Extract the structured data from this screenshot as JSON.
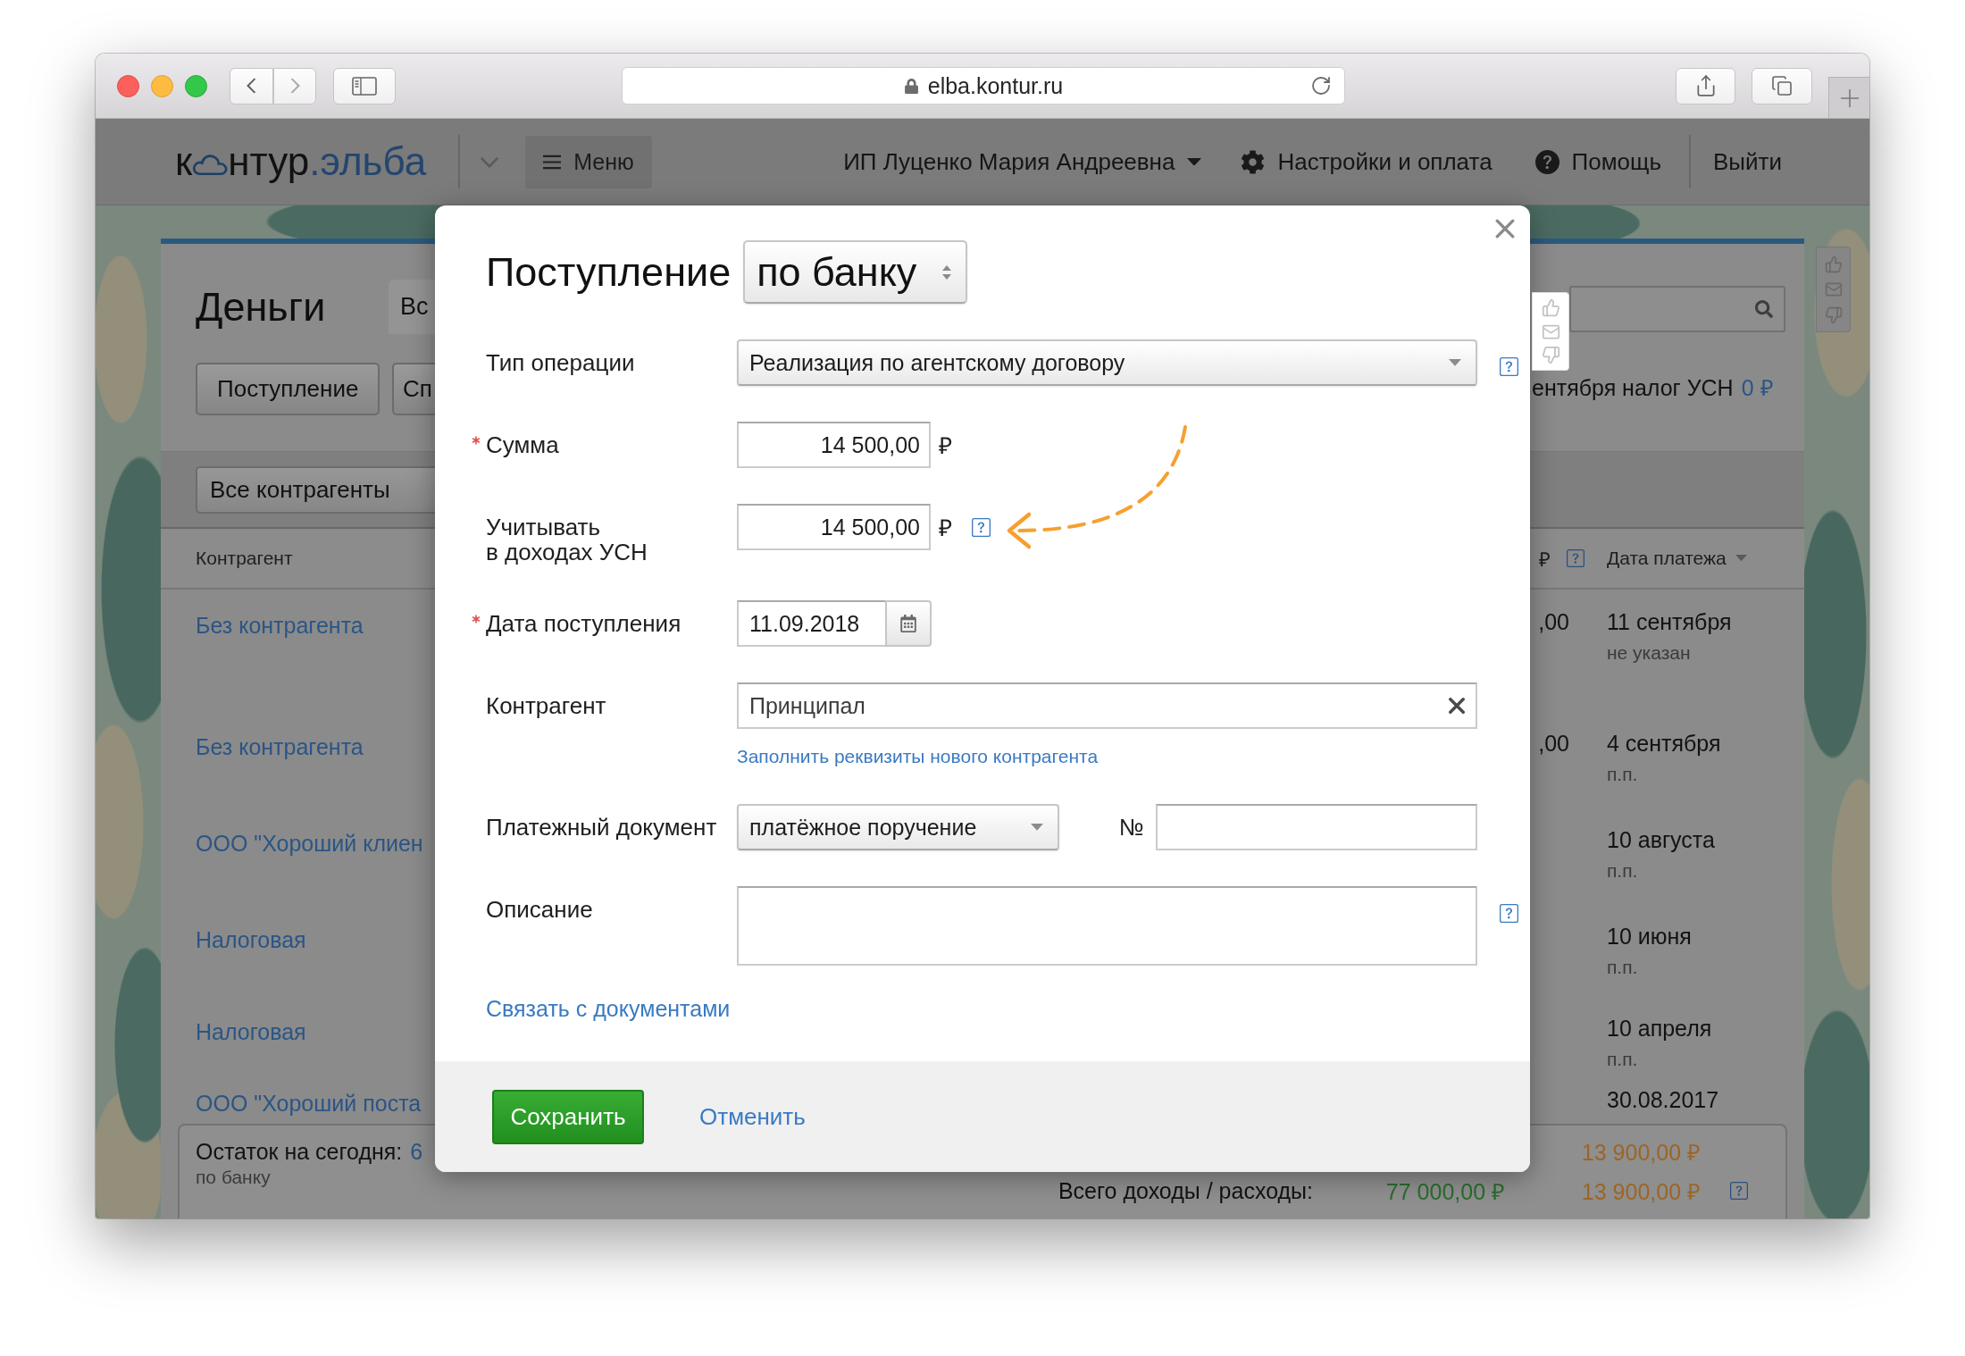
{
  "browser": {
    "url": "elba.kontur.ru"
  },
  "header": {
    "logo": {
      "first_letter": "к",
      "rest": "нтур",
      "product": ".эльба"
    },
    "menu": "Меню",
    "account": "ИП Луценко Мария Андреевна",
    "settings": "Настройки и оплата",
    "help": "Помощь",
    "logout": "Выйти"
  },
  "money": {
    "title": "Деньги",
    "tab": "Вс",
    "buttons": [
      "Поступление",
      "Сп"
    ],
    "tax_notice": "ентября налог УСН",
    "tax_amount": "0 ₽",
    "filter": "Все контрагенты",
    "columns": {
      "counterparty": "Контрагент",
      "currency": "₽",
      "date": "Дата платежа"
    },
    "rows": [
      {
        "counterparty": "Без контрагента",
        "amount": ",00",
        "date": "11 сентября",
        "document": "не указан"
      },
      {
        "counterparty": "Без контрагента",
        "amount": ",00",
        "date": "4 сентября",
        "document": "п.п."
      },
      {
        "counterparty": "ООО \"Хороший клиен",
        "date": "10 августа",
        "document": "п.п."
      },
      {
        "counterparty": "Налоговая",
        "date": "10 июня",
        "document": "п.п."
      },
      {
        "counterparty": "Налоговая",
        "date": "10 апреля",
        "document": "п.п."
      },
      {
        "counterparty": "ООО \"Хороший поста",
        "date": "30.08.2017"
      }
    ],
    "totals": {
      "balance_label": "Остаток на сегодня:",
      "balance_value": "6",
      "balance_note": "по банку",
      "today_expense": "13 900,00 ₽",
      "label": "Всего доходы / расходы:",
      "income": "77 000,00 ₽",
      "expense": "13 900,00 ₽"
    }
  },
  "modal": {
    "title": "Поступление",
    "source": "по банку",
    "annotation_arrow": true,
    "fields": [
      {
        "kind": "select",
        "label": "Тип операции",
        "required": false,
        "help": true,
        "value": "Реализация по агентскому договору"
      },
      {
        "kind": "money",
        "label": "Сумма",
        "required": true,
        "help": false,
        "value": "14 500,00",
        "currency": "₽"
      },
      {
        "kind": "money",
        "label": "Учитывать\nв доходах УСН",
        "required": false,
        "help": true,
        "value": "14 500,00",
        "currency": "₽"
      },
      {
        "kind": "date",
        "label": "Дата поступления",
        "required": true,
        "help": false,
        "value": "11.09.2018"
      },
      {
        "kind": "counterparty",
        "label": "Контрагент",
        "required": false,
        "help": false,
        "value": "Принципал",
        "link": "Заполнить реквизиты нового контрагента"
      },
      {
        "kind": "document",
        "label": "Платежный документ",
        "required": false,
        "help": false,
        "value": "платёжное поручение",
        "number_label": "№"
      },
      {
        "kind": "textarea",
        "label": "Описание",
        "required": false,
        "help": true
      }
    ],
    "link": "Связать с документами",
    "save": "Сохранить",
    "cancel": "Отменить"
  }
}
